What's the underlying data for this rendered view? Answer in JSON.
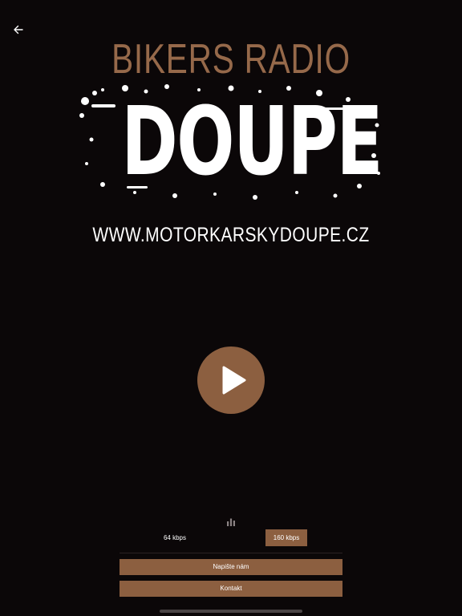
{
  "nav": {
    "back_icon": "arrow-left-icon"
  },
  "logo": {
    "line1": "BIKERS RADIO",
    "line2": "DOUPE"
  },
  "website": "WWW.MOTORKARSKYDOUPE.CZ",
  "player": {
    "play_icon": "play-icon",
    "stream_icon": "bar-chart-icon"
  },
  "bitrate": {
    "options": [
      "64 kbps",
      "160 kbps"
    ],
    "selected": "160 kbps"
  },
  "actions": {
    "write_us": "Napište nám",
    "contact": "Kontakt"
  },
  "colors": {
    "background": "#0b0708",
    "accent": "#8c5f40",
    "logo_brown": "#96694a",
    "text": "#ffffff"
  }
}
